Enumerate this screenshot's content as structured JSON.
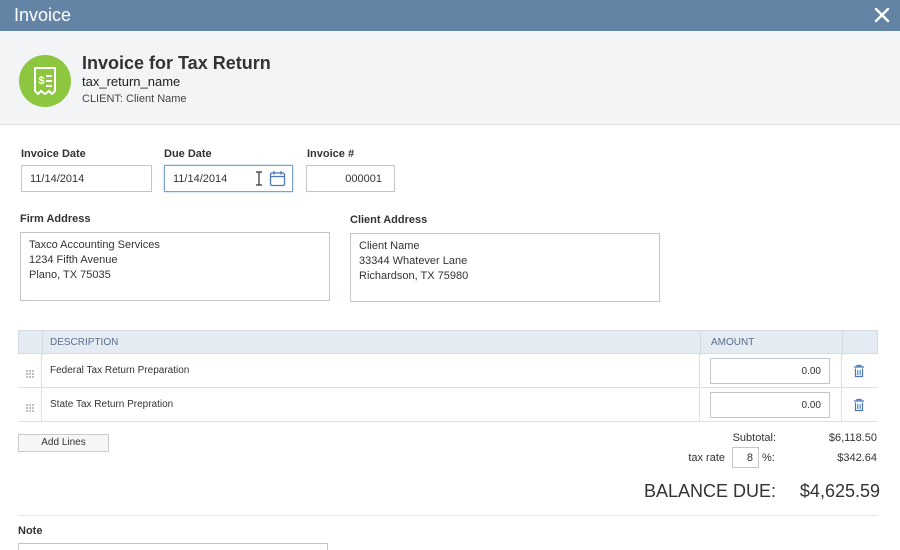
{
  "window": {
    "title": "Invoice"
  },
  "header": {
    "title": "Invoice for Tax Return",
    "name": "tax_return_name",
    "client_prefix": "CLIENT:",
    "client_name": "Client Name"
  },
  "fields": {
    "invoice_date": {
      "label": "Invoice Date",
      "value": "11/14/2014"
    },
    "due_date": {
      "label": "Due Date",
      "value": "11/14/2014"
    },
    "invoice_number": {
      "label": "Invoice #",
      "value": "000001"
    }
  },
  "firm_address": {
    "label": "Firm Address",
    "lines": [
      "Taxco Accounting Services",
      "1234 Fifth Avenue",
      "Plano, TX  75035"
    ]
  },
  "client_address": {
    "label": "Client Address",
    "lines": [
      "Client Name",
      "33344 Whatever Lane",
      "Richardson, TX  75980"
    ]
  },
  "table": {
    "headers": {
      "description": "DESCRIPTION",
      "amount": "AMOUNT"
    },
    "rows": [
      {
        "description": "Federal Tax Return Preparation",
        "amount": "0.00"
      },
      {
        "description": "State Tax Return Prepration",
        "amount": "0.00"
      }
    ]
  },
  "add_lines_label": "Add Lines",
  "totals": {
    "subtotal_label": "Subtotal:",
    "subtotal_value": "$6,118.50",
    "tax_label": "tax rate",
    "tax_rate": "8",
    "tax_suffix": "%:",
    "tax_value": "$342.64",
    "balance_label": "BALANCE DUE:",
    "balance_value": "$4,625.59"
  },
  "note": {
    "label": "Note"
  },
  "colors": {
    "titlebar": "#6484a6",
    "badge": "#8dc63f",
    "table_header": "#e4ebf3",
    "focus": "#7da2ce",
    "icon_blue": "#4a78b8"
  },
  "icons": {
    "close": "close-icon",
    "badge": "receipt-icon",
    "calendar": "calendar-icon",
    "grip": "drag-handle-icon",
    "trash": "trash-icon"
  }
}
